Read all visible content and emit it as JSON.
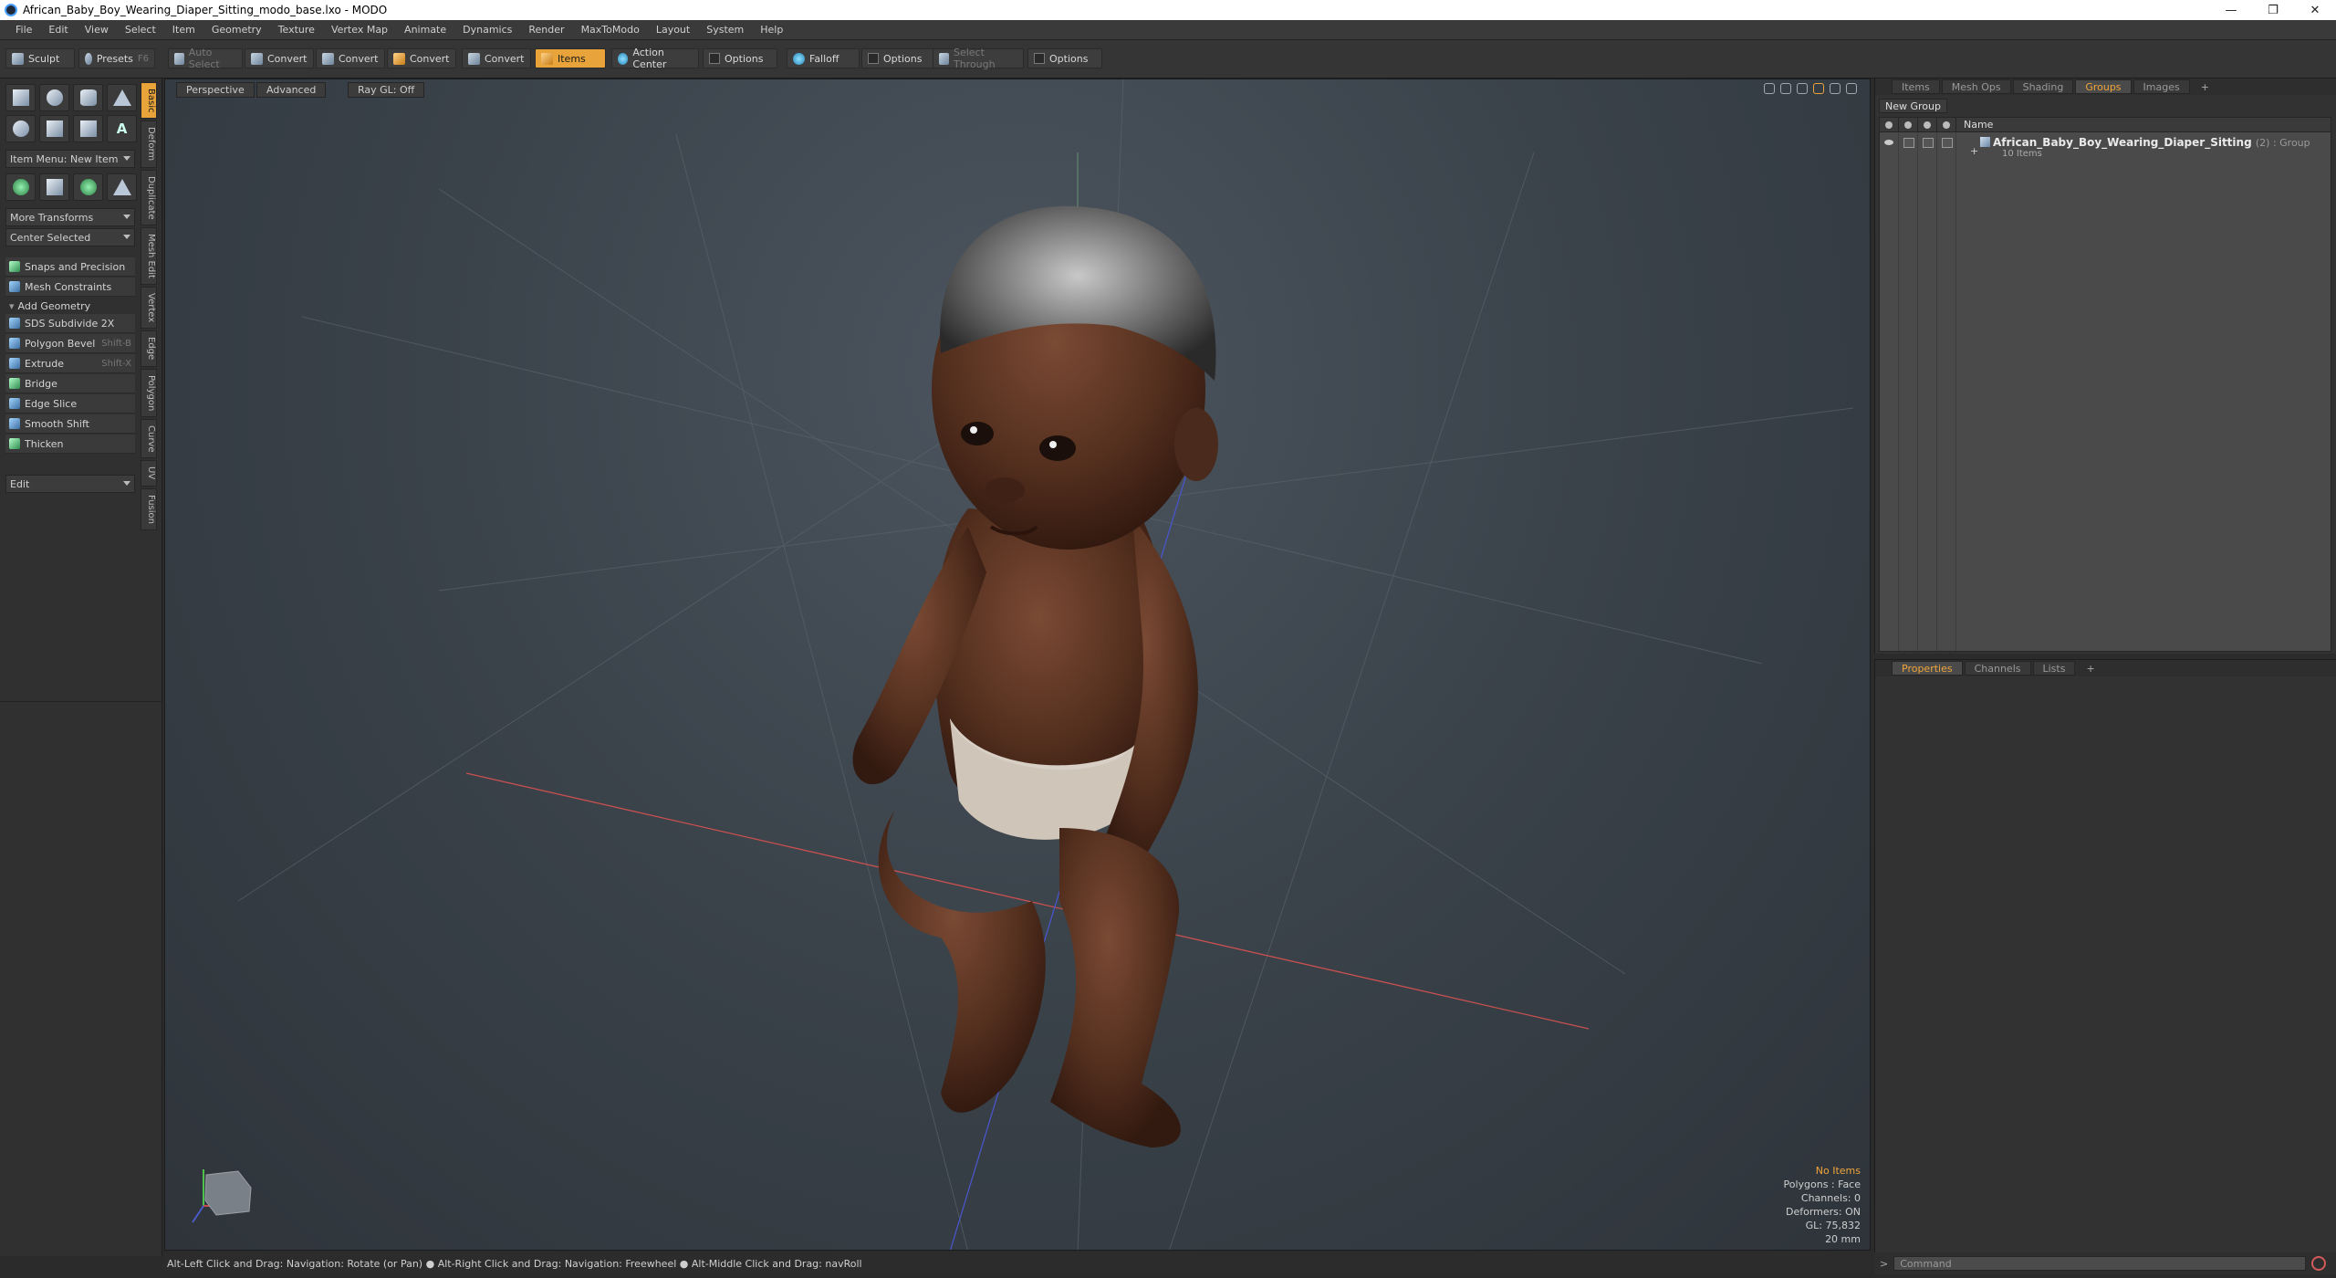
{
  "window": {
    "title": "African_Baby_Boy_Wearing_Diaper_Sitting_modo_base.lxo - MODO"
  },
  "menu": [
    "File",
    "Edit",
    "View",
    "Select",
    "Item",
    "Geometry",
    "Texture",
    "Vertex Map",
    "Animate",
    "Dynamics",
    "Render",
    "MaxToModo",
    "Layout",
    "System",
    "Help"
  ],
  "toolbar": {
    "sculpt": "Sculpt",
    "presets": "Presets",
    "presets_key": "F6",
    "auto_select": "Auto Select",
    "convert1": "Convert",
    "convert2": "Convert",
    "convert3": "Convert",
    "convert4": "Convert",
    "items": "Items",
    "action_center": "Action Center",
    "options1": "Options",
    "falloff": "Falloff",
    "options2": "Options",
    "select_through": "Select Through",
    "options3": "Options"
  },
  "left": {
    "item_menu": "Item Menu: New Item",
    "more_transforms": "More Transforms",
    "center_selected": "Center Selected",
    "snaps": "Snaps and Precision",
    "mesh_constraints": "Mesh Constraints",
    "add_geometry": "Add Geometry",
    "tools": [
      {
        "label": "SDS Subdivide 2X",
        "shortcut": ""
      },
      {
        "label": "Polygon Bevel",
        "shortcut": "Shift-B"
      },
      {
        "label": "Extrude",
        "shortcut": "Shift-X"
      },
      {
        "label": "Bridge",
        "shortcut": ""
      },
      {
        "label": "Edge Slice",
        "shortcut": ""
      },
      {
        "label": "Smooth Shift",
        "shortcut": ""
      },
      {
        "label": "Thicken",
        "shortcut": ""
      }
    ],
    "edit": "Edit",
    "vtabs": [
      "Basic",
      "Deform",
      "Duplicate",
      "Mesh Edit",
      "Vertex",
      "Edge",
      "Polygon",
      "Curve",
      "UV",
      "Fusion"
    ]
  },
  "viewport": {
    "tab_perspective": "Perspective",
    "tab_advanced": "Advanced",
    "tab_raygl": "Ray GL: Off",
    "info": {
      "no_items": "No Items",
      "polygons": "Polygons : Face",
      "channels": "Channels: 0",
      "deformers": "Deformers: ON",
      "gl": "GL: 75,832",
      "scale": "20 mm"
    }
  },
  "status": {
    "text": "Alt-Left Click and Drag: Navigation: Rotate (or Pan) ● Alt-Right Click and Drag: Navigation: Freewheel ● Alt-Middle Click and Drag: navRoll"
  },
  "right": {
    "tabs": [
      "Items",
      "Mesh Ops",
      "Shading",
      "Groups",
      "Images"
    ],
    "new_group": "New Group",
    "col_name": "Name",
    "group_name": "African_Baby_Boy_Wearing_Diaper_Sitting",
    "group_meta": "(2) : Group",
    "group_count": "10 Items",
    "ptabs": [
      "Properties",
      "Channels",
      "Lists"
    ]
  },
  "command": {
    "placeholder": "Command",
    "prompt": ">"
  }
}
